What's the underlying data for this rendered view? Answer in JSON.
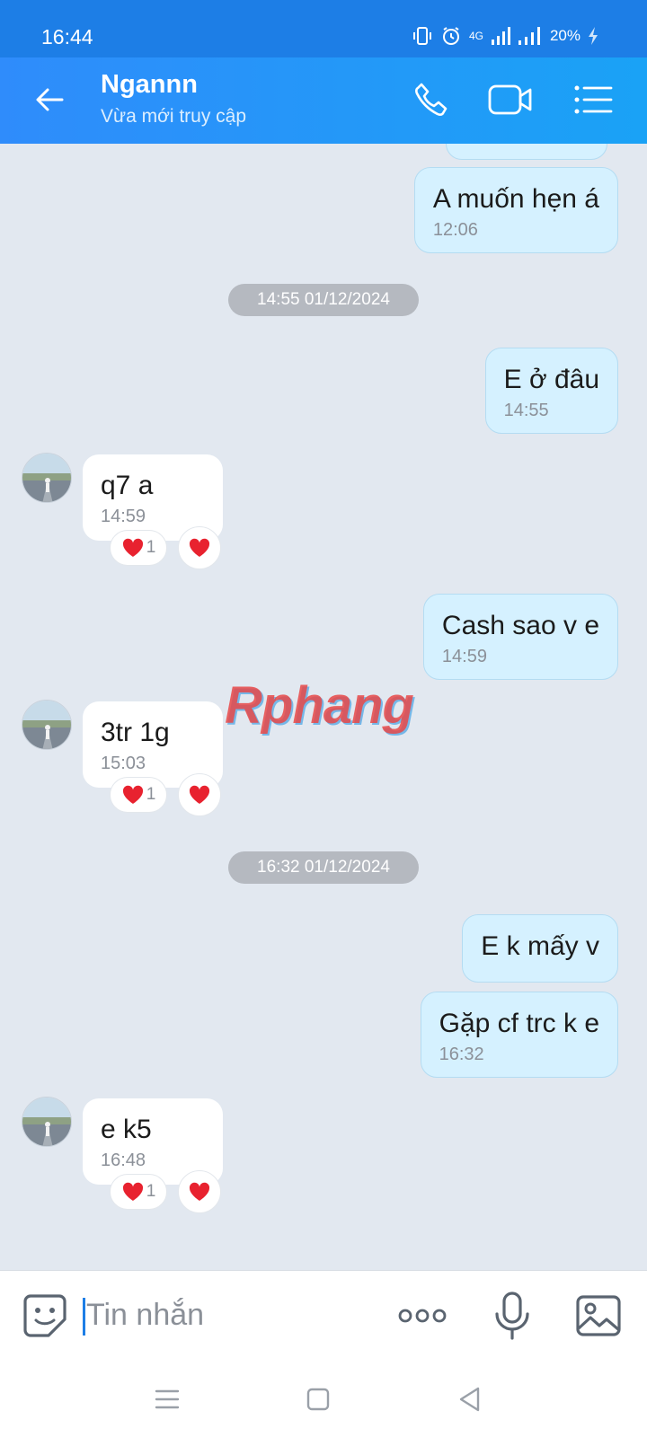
{
  "status_bar": {
    "time": "16:44",
    "network": "4G",
    "battery": "20%"
  },
  "header": {
    "contact_name": "Ngannn",
    "contact_status": "Vừa mới truy cập"
  },
  "messages": [
    {
      "text": "A muốn hẹn á",
      "time": "12:06"
    },
    {
      "separator": "14:55 01/12/2024"
    },
    {
      "text": "E ở đâu",
      "time": "14:55"
    },
    {
      "text": "q7 a",
      "time": "14:59",
      "reaction_count": "1"
    },
    {
      "text": "Cash sao v e",
      "time": "14:59"
    },
    {
      "text": "3tr 1g",
      "time": "15:03",
      "reaction_count": "1"
    },
    {
      "separator": "16:32 01/12/2024"
    },
    {
      "text": "E k mấy v"
    },
    {
      "text": "Gặp cf trc k e",
      "time": "16:32"
    },
    {
      "text": "e k5",
      "time": "16:48",
      "reaction_count": "1"
    }
  ],
  "watermark": "Rphang",
  "composer": {
    "placeholder": "Tin nhắn"
  },
  "icons": {
    "back": "arrow-left-icon",
    "call": "phone-icon",
    "video": "video-camera-icon",
    "menu": "list-menu-icon",
    "emoji": "sticker-icon",
    "more": "more-dots-icon",
    "mic": "microphone-icon",
    "image": "image-icon",
    "reaction": "heart-icon"
  },
  "colors": {
    "header": "#2f8cfb",
    "outgoing_bubble": "#d5f1ff",
    "incoming_bubble": "#ffffff",
    "chat_background": "#e2e8f0",
    "heart": "#e8222f"
  }
}
